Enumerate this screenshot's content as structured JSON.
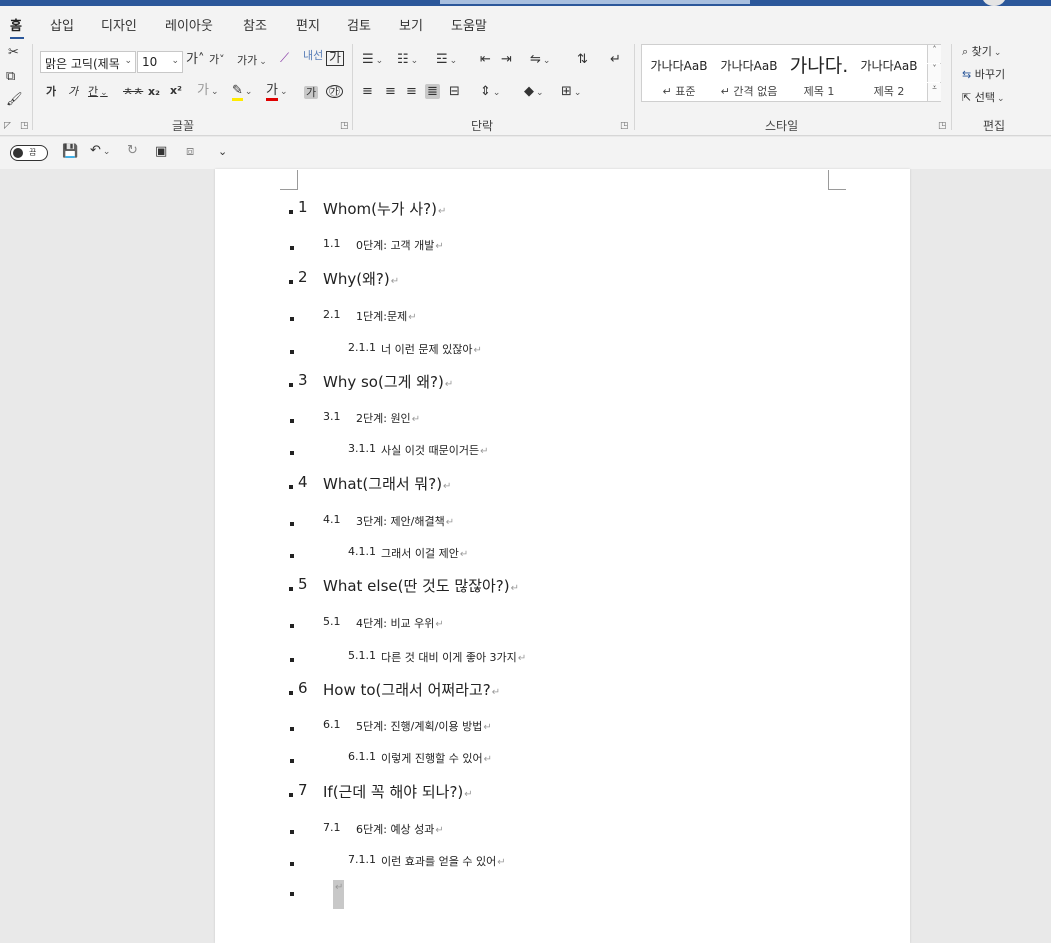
{
  "tabs": [
    "홈",
    "삽입",
    "디자인",
    "레이아웃",
    "참조",
    "편지",
    "검토",
    "보기",
    "도움말"
  ],
  "active_tab": "홈",
  "clipboard": {
    "icons": [
      "cut-icon",
      "copy-icon",
      "format-painter-icon"
    ]
  },
  "font": {
    "name": "맑은 고딕(제목",
    "size": "10",
    "grow_label": "가˄",
    "shrink_label": "가˅",
    "case_label": "가가",
    "bold": "가",
    "italic": "가",
    "underline": "간",
    "strike": "ㅊ",
    "sub": "x₂",
    "sup": "x²",
    "color_a": "가",
    "group_label": "글꼴"
  },
  "paragraph": {
    "group_label": "단락"
  },
  "styles": {
    "items": [
      {
        "preview": "가나다AaB",
        "name": "↵ 표준"
      },
      {
        "preview": "가나다AaB",
        "name": "↵ 간격 없음"
      },
      {
        "preview": "가나다.",
        "name": "제목 1"
      },
      {
        "preview": "가나다AaB",
        "name": "제목 2"
      }
    ],
    "group_label": "스타일"
  },
  "editing": {
    "find": "찾기",
    "replace": "바꾸기",
    "select": "선택",
    "group_label": "편집"
  },
  "qat": {
    "toggle_label": "끔"
  },
  "document": {
    "lines": [
      {
        "level": 1,
        "num": "1",
        "text": "Whom(누가 사?)"
      },
      {
        "level": 2,
        "num": "1.1",
        "text": "0단계: 고객 개발"
      },
      {
        "level": 1,
        "num": "2",
        "text": "Why(왜?)"
      },
      {
        "level": 2,
        "num": "2.1",
        "text": "1단계:문제"
      },
      {
        "level": 3,
        "num": "2.1.1",
        "text": "너 이런 문제 있잖아"
      },
      {
        "level": 1,
        "num": "3",
        "text": "Why so(그게 왜?)"
      },
      {
        "level": 2,
        "num": "3.1",
        "text": "2단계: 원인"
      },
      {
        "level": 3,
        "num": "3.1.1",
        "text": "사실 이것 때문이거든"
      },
      {
        "level": 1,
        "num": "4",
        "text": "What(그래서 뭐?)"
      },
      {
        "level": 2,
        "num": "4.1",
        "text": "3단계: 제안/해결책"
      },
      {
        "level": 3,
        "num": "4.1.1",
        "text": "그래서 이걸 제안"
      },
      {
        "level": 1,
        "num": "5",
        "text": "What else(딴 것도 많잖아?)"
      },
      {
        "level": 2,
        "num": "5.1",
        "text": "4단계: 비교 우위"
      },
      {
        "level": 3,
        "num": "5.1.1",
        "text": "다른 것 대비 이게 좋아 3가지"
      },
      {
        "level": 1,
        "num": "6",
        "text": "How to(그래서 어쩌라고?"
      },
      {
        "level": 2,
        "num": "6.1",
        "text": "5단계: 진행/계획/이용 방법"
      },
      {
        "level": 3,
        "num": "6.1.1",
        "text": "이렇게 진행할 수 있어"
      },
      {
        "level": 1,
        "num": "7",
        "text": "If(근데 꼭 해야 되나?)"
      },
      {
        "level": 2,
        "num": "7.1",
        "text": "6단계: 예상 성과"
      },
      {
        "level": 3,
        "num": "7.1.1",
        "text": "이런 효과를 얻을 수 있어"
      }
    ],
    "paragraph_mark": "↵"
  }
}
